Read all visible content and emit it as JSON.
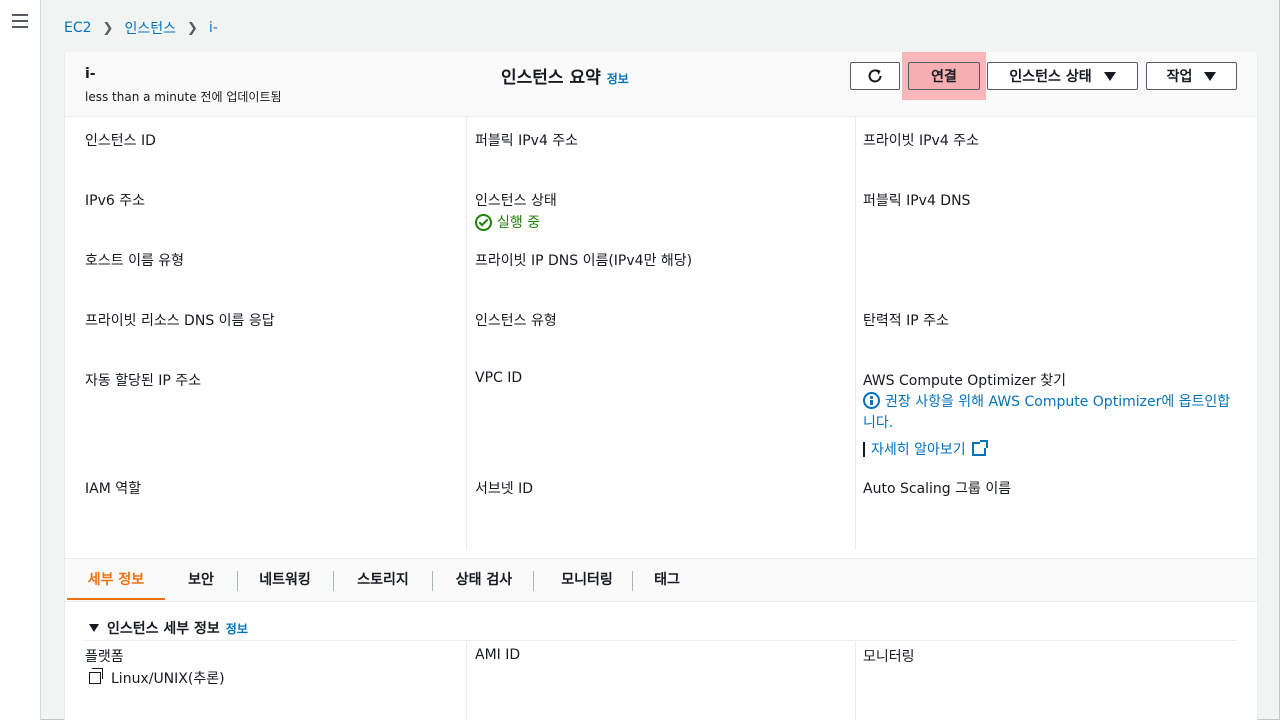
{
  "breadcrumb": {
    "root": "EC2",
    "section": "인스턴스",
    "current": "i-"
  },
  "header": {
    "instance_id": "i-",
    "updated": "less than a minute 전에 업데이트됨",
    "title": "인스턴스 요약",
    "info_label": "정보",
    "buttons": {
      "connect": "연결",
      "instance_state": "인스턴스 상태",
      "actions": "작업"
    }
  },
  "fields": {
    "instance_id": "인스턴스 ID",
    "public_ipv4": "퍼블릭 IPv4 주소",
    "private_ipv4": "프라이빗 IPv4 주소",
    "ipv6": "IPv6 주소",
    "instance_state": "인스턴스 상태",
    "public_ipv4_dns": "퍼블릭 IPv4 DNS",
    "hostname_type": "호스트 이름 유형",
    "private_ip_dns": "프라이빗 IP DNS 이름(IPv4만 해당)",
    "private_resource_dns": "프라이빗 리소스 DNS 이름 응답",
    "instance_type": "인스턴스 유형",
    "elastic_ip": "탄력적 IP 주소",
    "auto_ip": "자동 할당된 IP 주소",
    "vpc_id": "VPC ID",
    "compute_optimizer": "AWS Compute Optimizer 찾기",
    "iam_role": "IAM 역할",
    "subnet_id": "서브넷 ID",
    "asg_name": "Auto Scaling 그룹 이름"
  },
  "values": {
    "state": "실행 중",
    "optimizer_note": "권장 사항을 위해 AWS Compute Optimizer에 옵트인합니다.",
    "learn_more": "자세히 알아보기"
  },
  "tabs": [
    "세부 정보",
    "보안",
    "네트워킹",
    "스토리지",
    "상태 검사",
    "모니터링",
    "태그"
  ],
  "details": {
    "section_title": "인스턴스 세부 정보",
    "info_label": "정보",
    "platform_label": "플랫폼",
    "platform_value": "Linux/UNIX(추론)",
    "ami_label": "AMI ID",
    "monitoring_label": "모니터링"
  },
  "colors": {
    "link": "#0073bb",
    "active_tab": "#ec7211",
    "running": "#1d8102",
    "highlight": "#f9b7bb"
  },
  "icons": [
    "menu-icon",
    "refresh-icon",
    "caret-down-icon",
    "check-circle-icon",
    "info-icon",
    "external-link-icon",
    "copy-icon"
  ]
}
